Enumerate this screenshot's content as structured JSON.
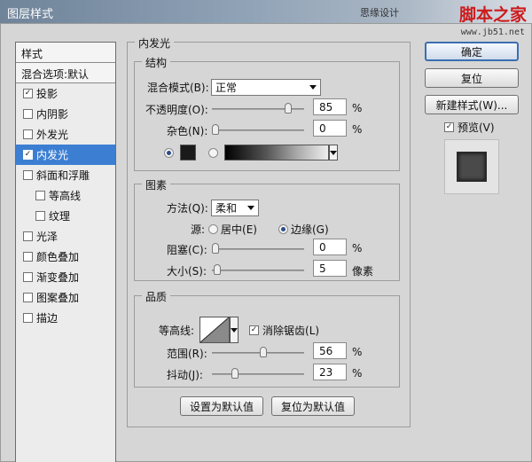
{
  "window": {
    "title": "图层样式",
    "watermark_small": "思缘设计",
    "watermark_brand": "脚本之家",
    "watermark_url": "www.jb51.net"
  },
  "stylelist": {
    "header": "样式",
    "blending": "混合选项:默认",
    "items": [
      {
        "label": "投影",
        "checked": true
      },
      {
        "label": "内阴影",
        "checked": false
      },
      {
        "label": "外发光",
        "checked": false
      },
      {
        "label": "内发光",
        "checked": true,
        "active": true
      },
      {
        "label": "斜面和浮雕",
        "checked": false
      },
      {
        "label": "等高线",
        "checked": false,
        "indent": true
      },
      {
        "label": "纹理",
        "checked": false,
        "indent": true
      },
      {
        "label": "光泽",
        "checked": false
      },
      {
        "label": "颜色叠加",
        "checked": false
      },
      {
        "label": "渐变叠加",
        "checked": false
      },
      {
        "label": "图案叠加",
        "checked": false
      },
      {
        "label": "描边",
        "checked": false
      }
    ]
  },
  "panel": {
    "title": "内发光",
    "structure": {
      "legend": "结构",
      "blend_mode_label": "混合模式(B):",
      "blend_mode_value": "正常",
      "opacity_label": "不透明度(O):",
      "opacity_value": "85",
      "opacity_pct": 0.85,
      "noise_label": "杂色(N):",
      "noise_value": "0",
      "noise_pct": 0.0,
      "unit": "%",
      "color_swatch": "#1a1a1a"
    },
    "elements": {
      "legend": "图素",
      "method_label": "方法(Q):",
      "method_value": "柔和",
      "source_label": "源:",
      "source_center": "居中(E)",
      "source_edge": "边缘(G)",
      "choke_label": "阻塞(C):",
      "choke_value": "0",
      "choke_pct": 0.0,
      "size_label": "大小(S):",
      "size_value": "5",
      "size_pct": 0.02,
      "unit_pct": "%",
      "unit_px": "像素"
    },
    "quality": {
      "legend": "品质",
      "contour_label": "等高线:",
      "antialias_label": "消除锯齿(L)",
      "range_label": "范围(R):",
      "range_value": "56",
      "range_pct": 0.56,
      "jitter_label": "抖动(J):",
      "jitter_value": "23",
      "jitter_pct": 0.23,
      "unit": "%"
    },
    "make_default": "设置为默认值",
    "reset_default": "复位为默认值"
  },
  "buttons": {
    "ok": "确定",
    "reset": "复位",
    "new_style": "新建样式(W)...",
    "preview": "预览(V)"
  }
}
